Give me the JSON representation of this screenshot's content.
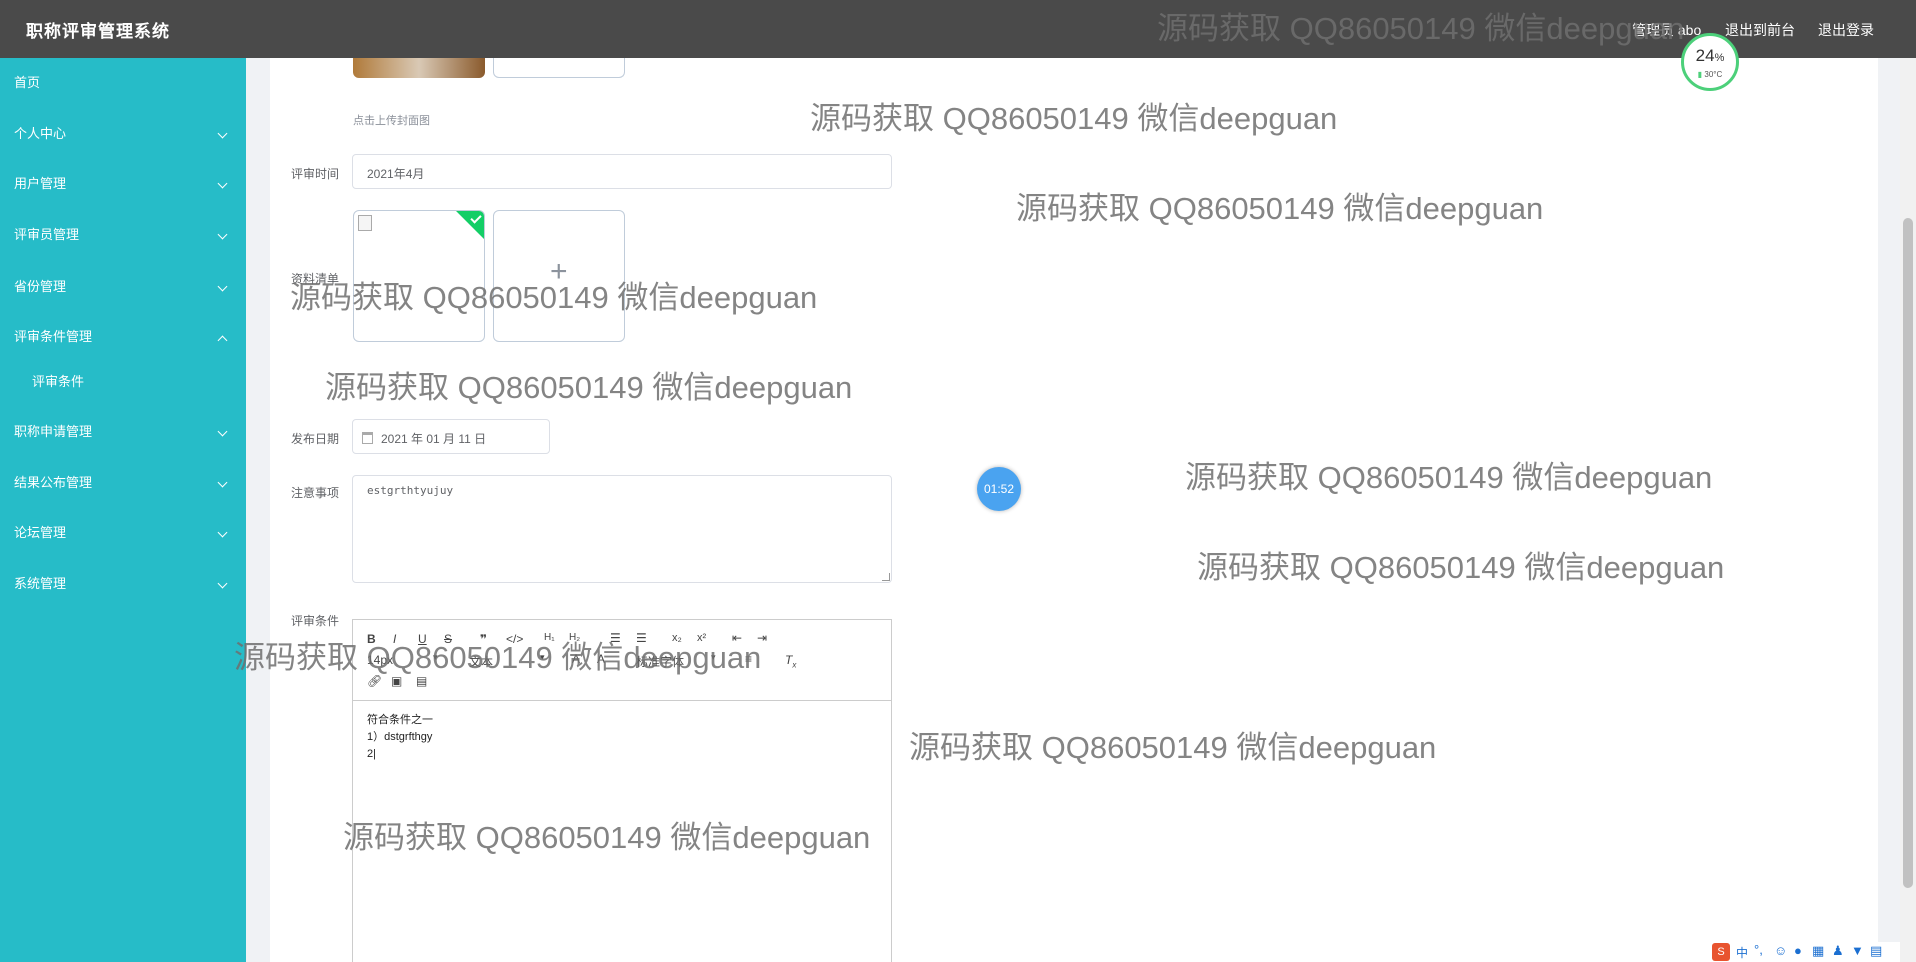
{
  "header": {
    "title": "职称评审管理系统",
    "user": "管理员 abo",
    "back_front": "退出到前台",
    "logout": "退出登录"
  },
  "sidebar": {
    "items": [
      {
        "label": "首页"
      },
      {
        "label": "个人中心"
      },
      {
        "label": "用户管理"
      },
      {
        "label": "评审员管理"
      },
      {
        "label": "省份管理"
      },
      {
        "label": "评审条件管理"
      },
      {
        "label": "评审条件"
      },
      {
        "label": "职称申请管理"
      },
      {
        "label": "结果公布管理"
      },
      {
        "label": "论坛管理"
      },
      {
        "label": "系统管理"
      }
    ]
  },
  "form": {
    "cover_hint": "点击上传封面图",
    "review_time_label": "评审时间",
    "review_time_value": "2021年4月",
    "materials_label": "资料清单",
    "upload_plus": "+",
    "publish_date_label": "发布日期",
    "publish_date_value": "2021 年 01 月 11 日",
    "notes_label": "注意事项",
    "notes_value": "estgrthtyujuy",
    "conditions_label": "评审条件",
    "editor": {
      "font_size": "14px",
      "font_type": "文本",
      "font_family": "标准字体",
      "lines": [
        "符合条件之一",
        "1）dstgrfthgy",
        "2|"
      ]
    }
  },
  "overlays": {
    "timer": "01:52",
    "battery_percent": "24",
    "battery_unit": "%",
    "temperature": "30°C"
  },
  "watermark_text": "源码获取 QQ86050149 微信deepguan",
  "colors": {
    "sidebar": "#26bcc8",
    "header": "#4a4a4a",
    "success": "#13ce66"
  }
}
